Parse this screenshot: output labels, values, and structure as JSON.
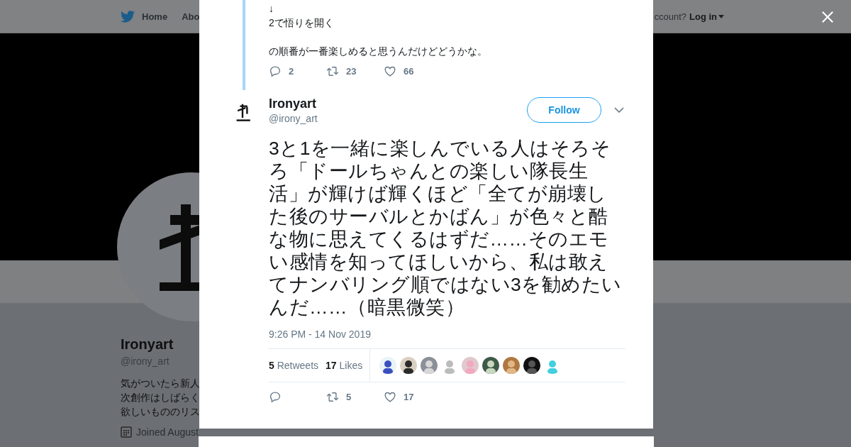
{
  "nav": {
    "items": [
      {
        "label": "Home"
      },
      {
        "label": "Abo"
      }
    ],
    "account_prompt": "ccount?",
    "login": "Log in"
  },
  "profile": {
    "name": "Ironyart",
    "handle": "@irony_art",
    "bio_lines": [
      "気がついたら新人",
      "次創作はしばらく",
      "欲しいもののリス"
    ],
    "joined": "Joined August"
  },
  "parent_tweet": {
    "paragraphs": [
      [
        "↓",
        "2で悟りを開く"
      ],
      [
        "の順番が一番楽しめると思うんだけどどうかな。"
      ]
    ],
    "replies": "2",
    "retweets": "23",
    "likes": "66"
  },
  "tweet": {
    "name": "Ironyart",
    "handle": "@irony_art",
    "follow": "Follow",
    "text": "3と1を一緒に楽しんでいる人はそろそろ「ドールちゃんとの楽しい隊長生活」が輝けば輝くほど「全てが崩壊した後のサーバルとかばん」が色々と酷な物に思えてくるはずだ……そのエモい感情を知ってほしいから、私は敢えてナンバリング順ではない3を勧めたいんだ……（暗黒微笑）",
    "time": "9:26 PM - 14 Nov 2019",
    "retweet_count": "5",
    "retweet_label": "Retweets",
    "like_count": "17",
    "like_label": "Likes",
    "retweets": "5",
    "likes": "17"
  }
}
